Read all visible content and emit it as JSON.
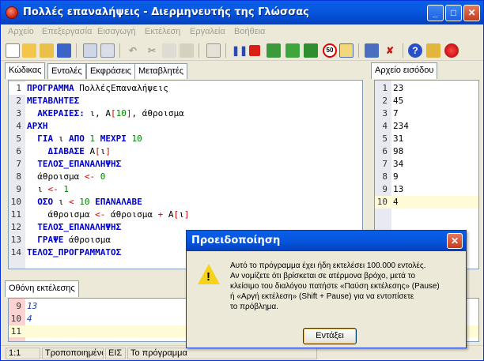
{
  "window": {
    "title": "Πολλές επαναλήψεις - Διερμηνευτής της Γλώσσας",
    "controls": {
      "minimize": "_",
      "maximize": "□",
      "close": "✕"
    }
  },
  "menu": [
    "Αρχείο",
    "Επεξεργασία",
    "Εισαγωγή",
    "Εκτέλεση",
    "Εργαλεία",
    "Βοήθεια"
  ],
  "toolbar": {
    "icons": [
      "new-file-icon",
      "open-folder-icon",
      "open-recent-icon",
      "save-icon",
      "print-preview-icon",
      "find-icon",
      "undo-icon",
      "cut-icon",
      "copy-icon",
      "paste-icon",
      "run-to-icon",
      "pause-icon",
      "stop-icon",
      "step-icon",
      "step-into-icon",
      "step-out-icon",
      "speed-50-icon",
      "slow-run-icon",
      "window-icon",
      "clear-breakpoints-icon",
      "help-icon",
      "settings-icon",
      "logo-icon"
    ],
    "speed_label": "50"
  },
  "left_tabs": [
    "Κώδικας",
    "Εντολές",
    "Εκφράσεις",
    "Μεταβλητές"
  ],
  "right_tab": "Αρχείο εισόδου",
  "output_tab": "Οθόνη εκτέλεσης",
  "code": [
    {
      "n": "1",
      "parts": [
        {
          "t": "ΠΡΟΓΡΑΜΜΑ ",
          "c": "kw"
        },
        {
          "t": "ΠολλέςΕπαναλήψεις",
          "c": ""
        }
      ]
    },
    {
      "n": "2",
      "parts": [
        {
          "t": "ΜΕΤΑΒΛΗΤΕΣ",
          "c": "kw"
        }
      ]
    },
    {
      "n": "3",
      "parts": [
        {
          "t": "  ΑΚΕΡΑΙΕΣ: ",
          "c": "kw"
        },
        {
          "t": "ι, Α",
          "c": ""
        },
        {
          "t": "[",
          "c": "op"
        },
        {
          "t": "10",
          "c": "num"
        },
        {
          "t": "]",
          "c": "op"
        },
        {
          "t": ", άθροισμα",
          "c": ""
        }
      ]
    },
    {
      "n": "4",
      "parts": [
        {
          "t": "ΑΡΧΗ",
          "c": "kw"
        }
      ]
    },
    {
      "n": "5",
      "parts": [
        {
          "t": "  ΓΙΑ ",
          "c": "kw"
        },
        {
          "t": "ι ",
          "c": ""
        },
        {
          "t": "ΑΠΟ ",
          "c": "kw"
        },
        {
          "t": "1 ",
          "c": "num"
        },
        {
          "t": "ΜΕΧΡΙ ",
          "c": "kw"
        },
        {
          "t": "10",
          "c": "num"
        }
      ]
    },
    {
      "n": "6",
      "parts": [
        {
          "t": "    ΔΙΑΒΑΣΕ ",
          "c": "kw"
        },
        {
          "t": "Α",
          "c": ""
        },
        {
          "t": "[",
          "c": "op"
        },
        {
          "t": "ι",
          "c": ""
        },
        {
          "t": "]",
          "c": "op"
        }
      ]
    },
    {
      "n": "7",
      "parts": [
        {
          "t": "  ΤΕΛΟΣ_ΕΠΑΝΑΛΗΨΗΣ",
          "c": "kw"
        }
      ]
    },
    {
      "n": "8",
      "parts": [
        {
          "t": "  άθροισμα ",
          "c": ""
        },
        {
          "t": "<- ",
          "c": "op"
        },
        {
          "t": "0",
          "c": "num"
        }
      ]
    },
    {
      "n": "9",
      "parts": [
        {
          "t": "  ι ",
          "c": ""
        },
        {
          "t": "<- ",
          "c": "op"
        },
        {
          "t": "1",
          "c": "num"
        }
      ]
    },
    {
      "n": "10",
      "parts": [
        {
          "t": "  ΟΣΟ ",
          "c": "kw"
        },
        {
          "t": "ι ",
          "c": ""
        },
        {
          "t": "< ",
          "c": "op"
        },
        {
          "t": "10 ",
          "c": "num"
        },
        {
          "t": "ΕΠΑΝΑΛΑΒΕ",
          "c": "kw"
        }
      ]
    },
    {
      "n": "11",
      "parts": [
        {
          "t": "    άθροισμα ",
          "c": ""
        },
        {
          "t": "<- ",
          "c": "op"
        },
        {
          "t": "άθροισμα ",
          "c": ""
        },
        {
          "t": "+ ",
          "c": "op"
        },
        {
          "t": "Α",
          "c": ""
        },
        {
          "t": "[",
          "c": "op"
        },
        {
          "t": "ι",
          "c": ""
        },
        {
          "t": "]",
          "c": "op"
        }
      ]
    },
    {
      "n": "12",
      "parts": [
        {
          "t": "  ΤΕΛΟΣ_ΕΠΑΝΑΛΗΨΗΣ",
          "c": "kw"
        }
      ]
    },
    {
      "n": "13",
      "parts": [
        {
          "t": "  ΓΡΑΨΕ ",
          "c": "kw"
        },
        {
          "t": "άθροισμα",
          "c": ""
        }
      ]
    },
    {
      "n": "14",
      "parts": [
        {
          "t": "ΤΕΛΟΣ_ΠΡΟΓΡΑΜΜΑΤΟΣ",
          "c": "kw"
        }
      ]
    }
  ],
  "input_file": [
    {
      "n": "1",
      "v": "23"
    },
    {
      "n": "2",
      "v": "45"
    },
    {
      "n": "3",
      "v": "7"
    },
    {
      "n": "4",
      "v": "234"
    },
    {
      "n": "5",
      "v": "31"
    },
    {
      "n": "6",
      "v": "98"
    },
    {
      "n": "7",
      "v": "34"
    },
    {
      "n": "8",
      "v": "9"
    },
    {
      "n": "9",
      "v": "13"
    },
    {
      "n": "10",
      "v": "4"
    }
  ],
  "output": [
    {
      "n": "9",
      "v": "13"
    },
    {
      "n": "10",
      "v": "4"
    },
    {
      "n": "11",
      "v": ""
    }
  ],
  "status": [
    "1:1",
    "Τροποποιημένο",
    "ΕΙΣ",
    "Το πρόγραμμα"
  ],
  "dialog": {
    "title": "Προειδοποίηση",
    "lines": [
      "Αυτό το πρόγραμμα έχει ήδη εκτελέσει 100.000 εντολές.",
      "Αν νομίζετε ότι βρίσκεται σε ατέρμονα βρόχο, μετά το",
      "κλείσιμο του διαλόγου πατήστε «Παύση εκτέλεσης» (Pause)",
      "ή «Αργή εκτέλεση» (Shift + Pause) για να εντοπίσετε",
      " το πρόβλημα."
    ],
    "ok_label": "Εντάξει",
    "warning_mark": "!"
  }
}
